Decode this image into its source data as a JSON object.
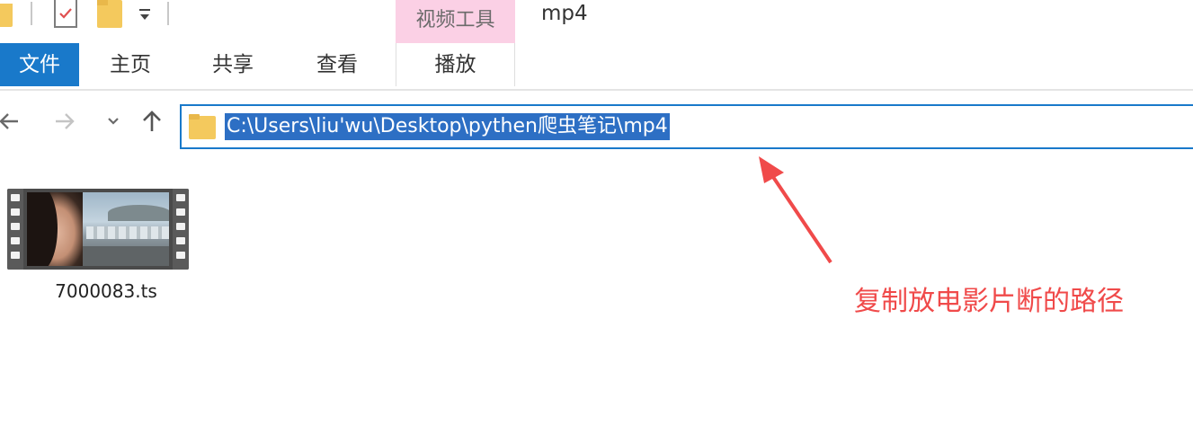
{
  "title_bar": {
    "contextual_tab_label": "视频工具",
    "window_title": "mp4"
  },
  "ribbon": {
    "tabs": [
      {
        "label": "文件",
        "active": true
      },
      {
        "label": "主页"
      },
      {
        "label": "共享"
      },
      {
        "label": "查看"
      },
      {
        "label": "播放"
      }
    ]
  },
  "navigation": {
    "address_path": "C:\\Users\\liu'wu\\Desktop\\pythen爬虫笔记\\mp4"
  },
  "files": [
    {
      "name": "7000083.ts",
      "type": "video"
    }
  ],
  "annotation": {
    "text": "复制放电影片断的路径",
    "color": "#f04a4a"
  },
  "colors": {
    "accent": "#1979ca",
    "selection": "#2d6fc4",
    "contextual_tab": "#fbd0e5",
    "folder": "#f4c95d"
  }
}
